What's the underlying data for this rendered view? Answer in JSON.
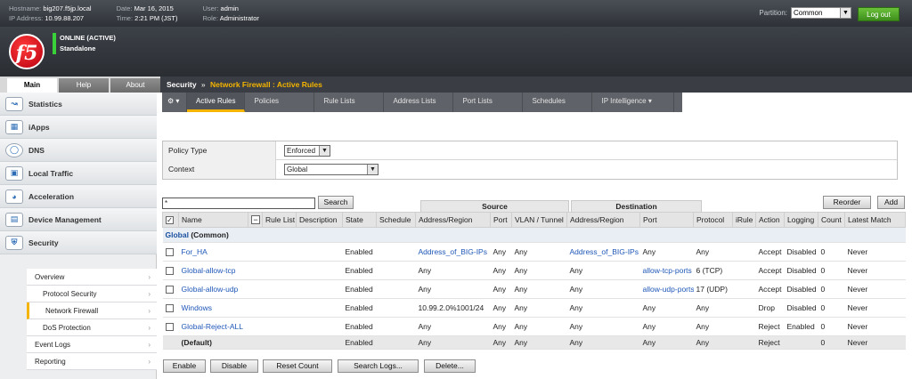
{
  "topbar": {
    "hostname_label": "Hostname:",
    "hostname": "big207.f5jp.local",
    "ip_label": "IP Address:",
    "ip": "10.99.88.207",
    "date_label": "Date:",
    "date": "Mar 16, 2015",
    "time_label": "Time:",
    "time": "2:21 PM (JST)",
    "user_label": "User:",
    "user": "admin",
    "role_label": "Role:",
    "role": "Administrator",
    "partition_label": "Partition:",
    "partition_value": "Common",
    "logout_label": "Log out"
  },
  "header": {
    "logo_text": "f5",
    "status_line1": "ONLINE (ACTIVE)",
    "status_line2": "Standalone",
    "status_color": "#3ad03a"
  },
  "maintabs": [
    {
      "label": "Main",
      "active": true
    },
    {
      "label": "Help",
      "active": false
    },
    {
      "label": "About",
      "active": false
    }
  ],
  "breadcrumb": {
    "root": "Security",
    "sep": "»",
    "current": "Network Firewall : Active Rules"
  },
  "sidebar": {
    "items": [
      {
        "label": "Statistics",
        "icon": "statistics-icon"
      },
      {
        "label": "iApps",
        "icon": "iapps-icon"
      },
      {
        "label": "DNS",
        "icon": "dns-icon"
      },
      {
        "label": "Local Traffic",
        "icon": "local-traffic-icon"
      },
      {
        "label": "Acceleration",
        "icon": "acceleration-icon"
      },
      {
        "label": "Device Management",
        "icon": "device-management-icon"
      },
      {
        "label": "Security",
        "icon": "security-shield-icon"
      }
    ],
    "subitems": [
      {
        "label": "Overview"
      },
      {
        "label": "Protocol Security"
      },
      {
        "label": "Network Firewall"
      },
      {
        "label": "DoS Protection"
      },
      {
        "label": "Event Logs"
      },
      {
        "label": "Reporting"
      }
    ]
  },
  "subnav": {
    "tabs": [
      "Active Rules",
      "Policies",
      "Rule Lists",
      "Address Lists",
      "Port Lists",
      "Schedules",
      "IP Intelligence"
    ]
  },
  "policy": {
    "type_label": "Policy Type",
    "type_value": "Enforced",
    "context_label": "Context",
    "context_value": "Global"
  },
  "rules": {
    "search_value": "*",
    "search_label": "Search",
    "reorder_label": "Reorder",
    "add_label": "Add",
    "source_header": "Source",
    "destination_header": "Destination",
    "columns": [
      "Name",
      "Rule List",
      "Description",
      "State",
      "Schedule",
      "Address/Region",
      "Port",
      "VLAN / Tunnel",
      "Address/Region",
      "Port",
      "Protocol",
      "iRule",
      "Action",
      "Logging",
      "Count",
      "Latest Match"
    ],
    "group_name": "Global",
    "group_suffix": "(Common)",
    "rows": [
      {
        "name": "For_HA",
        "state": "Enabled",
        "src_addr": "Address_of_BIG-IPs",
        "src_port": "Any",
        "vlan": "Any",
        "dst_addr": "Address_of_BIG-IPs",
        "dst_port": "Any",
        "protocol": "Any",
        "action": "Accept",
        "logging": "Disabled",
        "count": "0",
        "latest": "Never"
      },
      {
        "name": "Global-allow-tcp",
        "state": "Enabled",
        "src_addr": "Any",
        "src_port": "Any",
        "vlan": "Any",
        "dst_addr": "Any",
        "dst_port": "allow-tcp-ports",
        "protocol": "6 (TCP)",
        "action": "Accept",
        "logging": "Disabled",
        "count": "0",
        "latest": "Never"
      },
      {
        "name": "Global-allow-udp",
        "state": "Enabled",
        "src_addr": "Any",
        "src_port": "Any",
        "vlan": "Any",
        "dst_addr": "Any",
        "dst_port": "allow-udp-ports",
        "protocol": "17 (UDP)",
        "action": "Accept",
        "logging": "Disabled",
        "count": "0",
        "latest": "Never"
      },
      {
        "name": "Windows",
        "state": "Enabled",
        "src_addr": "10.99.2.0%1001/24",
        "src_port": "Any",
        "vlan": "Any",
        "dst_addr": "Any",
        "dst_port": "Any",
        "protocol": "Any",
        "action": "Drop",
        "logging": "Disabled",
        "count": "0",
        "latest": "Never"
      },
      {
        "name": "Global-Reject-ALL",
        "state": "Enabled",
        "src_addr": "Any",
        "src_port": "Any",
        "vlan": "Any",
        "dst_addr": "Any",
        "dst_port": "Any",
        "protocol": "Any",
        "action": "Reject",
        "logging": "Enabled",
        "count": "0",
        "latest": "Never"
      }
    ],
    "default_row": {
      "name": "(Default)",
      "state": "Enabled",
      "src_addr": "Any",
      "src_port": "Any",
      "vlan": "Any",
      "dst_addr": "Any",
      "dst_port": "Any",
      "protocol": "Any",
      "action": "Reject",
      "count": "0",
      "latest": "Never"
    }
  },
  "actions": {
    "enable": "Enable",
    "disable": "Disable",
    "reset_count": "Reset Count",
    "search_logs": "Search Logs...",
    "delete": "Delete..."
  },
  "colors": {
    "accent": "#f4b400",
    "link": "#1f57b8",
    "logout": "#4fa62a"
  }
}
